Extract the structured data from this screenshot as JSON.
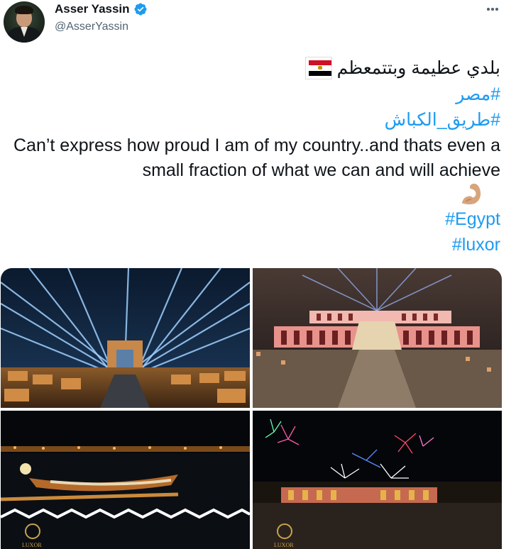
{
  "author": {
    "display_name": "Asser Yassin",
    "handle": "@AsserYassin",
    "verified": true,
    "avatar_icon": "profile-photo"
  },
  "tweet": {
    "arabic_line": "بلدي عظيمة وبتتمعظم",
    "flag_icon": "egypt-flag-icon",
    "hashtag_misr": "#مصر",
    "hashtag_kebash": "#طريق_الكباش",
    "english_text": "Can’t express how proud I am of my country..and thats even a small fraction of what we can and will achieve",
    "emoji_icon": "flexed-biceps-icon",
    "hashtag_egypt": "#Egypt",
    "hashtag_luxor": "#luxor"
  },
  "media": {
    "count": 4,
    "images": [
      {
        "name": "avenue-of-sphinxes-light-beams"
      },
      {
        "name": "hatshepsut-temple-illuminated"
      },
      {
        "name": "nile-royal-boats-night"
      },
      {
        "name": "fireworks-over-luxor"
      }
    ],
    "watermark_text": "LUXOR"
  },
  "colors": {
    "link": "#1d9bf0",
    "text": "#0f1419",
    "secondary": "#536471",
    "verified": "#1d9bf0"
  }
}
